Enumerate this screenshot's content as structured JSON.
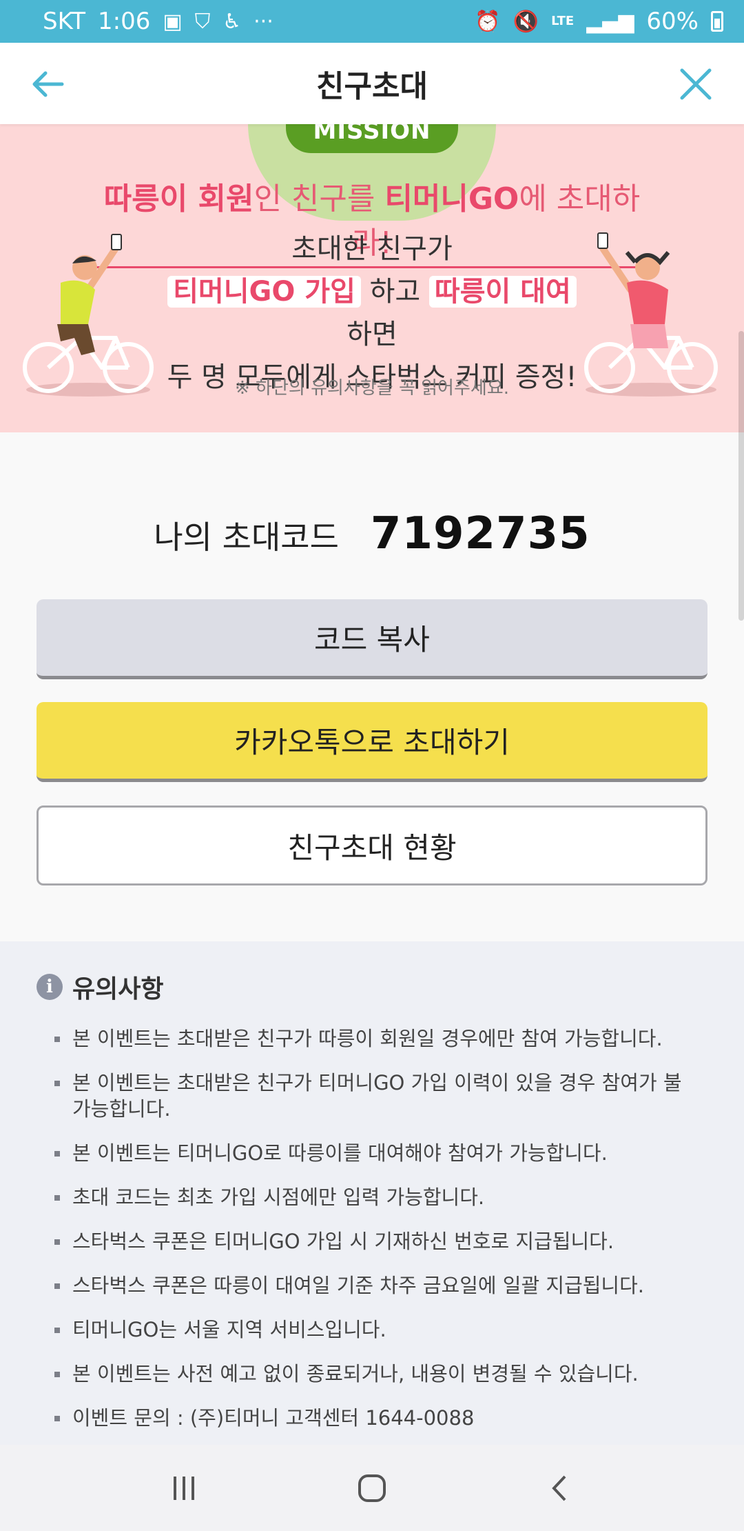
{
  "status_bar": {
    "carrier": "SKT",
    "time": "1:06",
    "network": "LTE",
    "battery": "60%"
  },
  "header": {
    "title": "친구초대"
  },
  "banner": {
    "badge": "MISSION",
    "headline_a": "따릉이 회원",
    "headline_b": "인 친구를 ",
    "headline_c": "티머니GO",
    "headline_d": "에 초대하라!",
    "line1": "초대한 친구가",
    "line2_hl1": "티머니GO 가입",
    "line2_mid": " 하고 ",
    "line2_hl2": "따릉이 대여",
    "line2_end": " 하면",
    "line3": "두 명 모두에게 스타벅스 커피 증정!",
    "note": "※ 하단의 유의사항을 꼭 읽어주세요."
  },
  "invite": {
    "label": "나의 초대코드",
    "code": "7192735"
  },
  "buttons": {
    "copy": "코드 복사",
    "kakao": "카카오톡으로 초대하기",
    "status": "친구초대 현황"
  },
  "notice": {
    "title": "유의사항",
    "items": [
      "본 이벤트는 초대받은 친구가 따릉이 회원일 경우에만 참여 가능합니다.",
      "본 이벤트는 초대받은 친구가 티머니GO 가입 이력이 있을 경우 참여가 불가능합니다.",
      "본 이벤트는 티머니GO로 따릉이를 대여해야 참여가 가능합니다.",
      "초대 코드는 최초 가입 시점에만 입력 가능합니다.",
      "스타벅스 쿠폰은 티머니GO 가입 시 기재하신 번호로 지급됩니다.",
      "스타벅스 쿠폰은 따릉이 대여일 기준 차주 금요일에 일괄 지급됩니다.",
      "티머니GO는 서울 지역 서비스입니다.",
      "본 이벤트는 사전 예고 없이 종료되거나, 내용이 변경될 수 있습니다.",
      "이벤트 문의 : (주)티머니 고객센터 1644-0088"
    ]
  },
  "colors": {
    "status_bar": "#4bb7d3",
    "accent": "#4bb7d3",
    "banner_bg": "#fdd7d7",
    "headline": "#e9496b",
    "kakao": "#f5df4d"
  }
}
